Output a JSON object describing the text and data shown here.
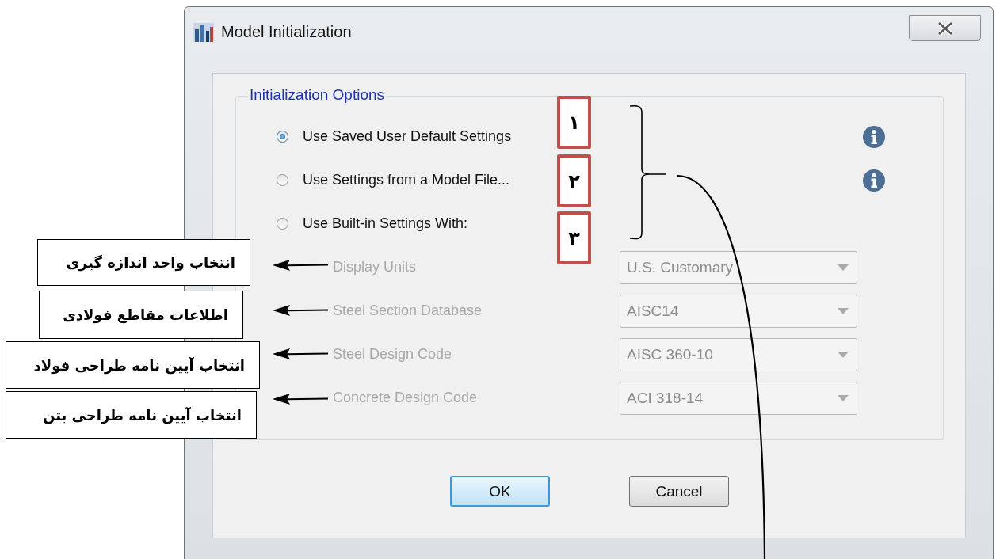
{
  "window": {
    "title": "Model Initialization"
  },
  "group": {
    "title": "Initialization Options"
  },
  "options": [
    {
      "label": "Use Saved User Default Settings",
      "selected": true,
      "info": true
    },
    {
      "label": "Use Settings from a Model File...",
      "selected": false,
      "info": true
    },
    {
      "label": "Use Built-in Settings With:",
      "selected": false,
      "info": false
    }
  ],
  "settings": [
    {
      "label": "Display Units",
      "value": "U.S. Customary",
      "disabled": true
    },
    {
      "label": "Steel Section Database",
      "value": "AISC14",
      "disabled": true
    },
    {
      "label": "Steel Design Code",
      "value": "AISC 360-10",
      "disabled": true
    },
    {
      "label": "Concrete Design Code",
      "value": "ACI 318-14",
      "disabled": true
    }
  ],
  "buttons": [
    {
      "label": "OK",
      "default": true
    },
    {
      "label": "Cancel",
      "default": false
    }
  ],
  "annotations": {
    "number_badges": [
      "۱",
      "۲",
      "۳"
    ],
    "callouts": [
      "انتخاب واحد اندازه گیری",
      "اطلاعات مقاطع فولادی",
      "انتخاب آیین نامه طراحی فولاد",
      "انتخاب آیین نامه طراحی بتن"
    ]
  }
}
